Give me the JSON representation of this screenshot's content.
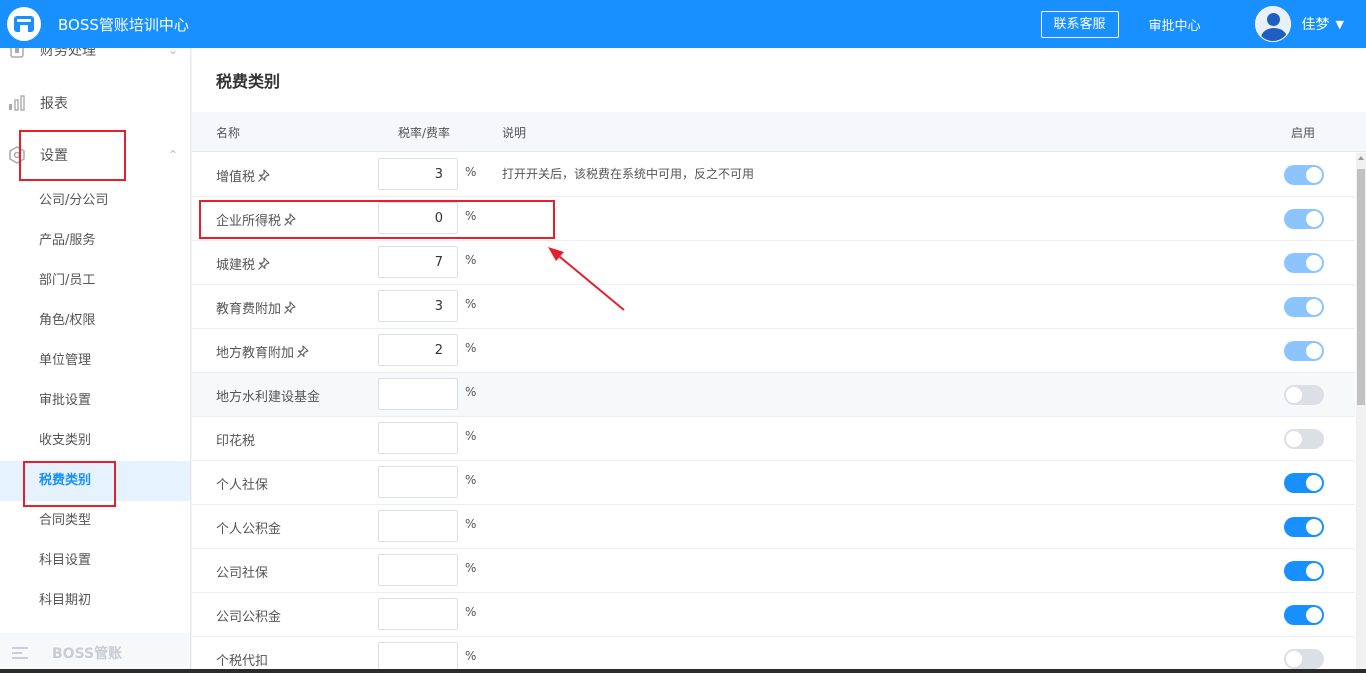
{
  "header": {
    "app_title": "BOSS管账培训中心",
    "contact_button": "联系客服",
    "approval_link": "审批中心",
    "user_name": "佳梦",
    "accent_color": "#1890ff"
  },
  "sidebar": {
    "group_finance": "财务处理",
    "group_reports": "报表",
    "group_settings": "设置",
    "items": [
      {
        "label": "公司/分公司"
      },
      {
        "label": "产品/服务"
      },
      {
        "label": "部门/员工"
      },
      {
        "label": "角色/权限"
      },
      {
        "label": "单位管理"
      },
      {
        "label": "审批设置"
      },
      {
        "label": "收支类别"
      },
      {
        "label": "税费类别",
        "active": true
      },
      {
        "label": "合同类型"
      },
      {
        "label": "科目设置"
      },
      {
        "label": "科目期初"
      }
    ],
    "bottom_label": "BOSS管账"
  },
  "main": {
    "page_title": "税费类别",
    "columns": {
      "name": "名称",
      "rate": "税率/费率",
      "desc": "说明",
      "enabled": "启用"
    },
    "percent_sign": "%",
    "rows": [
      {
        "name": "增值税",
        "pinned": true,
        "rate": "3",
        "desc": "打开开关后，该税费在系统中可用，反之不可用",
        "enabled": "on-light"
      },
      {
        "name": "企业所得税",
        "pinned": true,
        "rate": "0",
        "desc": "",
        "enabled": "on-light"
      },
      {
        "name": "城建税",
        "pinned": true,
        "rate": "7",
        "desc": "",
        "enabled": "on-light"
      },
      {
        "name": "教育费附加",
        "pinned": true,
        "rate": "3",
        "desc": "",
        "enabled": "on-light"
      },
      {
        "name": "地方教育附加",
        "pinned": true,
        "rate": "2",
        "desc": "",
        "enabled": "on-light"
      },
      {
        "name": "地方水利建设基金",
        "pinned": false,
        "rate": "",
        "desc": "",
        "enabled": "off"
      },
      {
        "name": "印花税",
        "pinned": false,
        "rate": "",
        "desc": "",
        "enabled": "off"
      },
      {
        "name": "个人社保",
        "pinned": false,
        "rate": "",
        "desc": "",
        "enabled": "on"
      },
      {
        "name": "个人公积金",
        "pinned": false,
        "rate": "",
        "desc": "",
        "enabled": "on"
      },
      {
        "name": "公司社保",
        "pinned": false,
        "rate": "",
        "desc": "",
        "enabled": "on"
      },
      {
        "name": "公司公积金",
        "pinned": false,
        "rate": "",
        "desc": "",
        "enabled": "on"
      },
      {
        "name": "个税代扣",
        "pinned": false,
        "rate": "",
        "desc": "",
        "enabled": "off"
      }
    ]
  },
  "annotation_color": "#e5202c"
}
